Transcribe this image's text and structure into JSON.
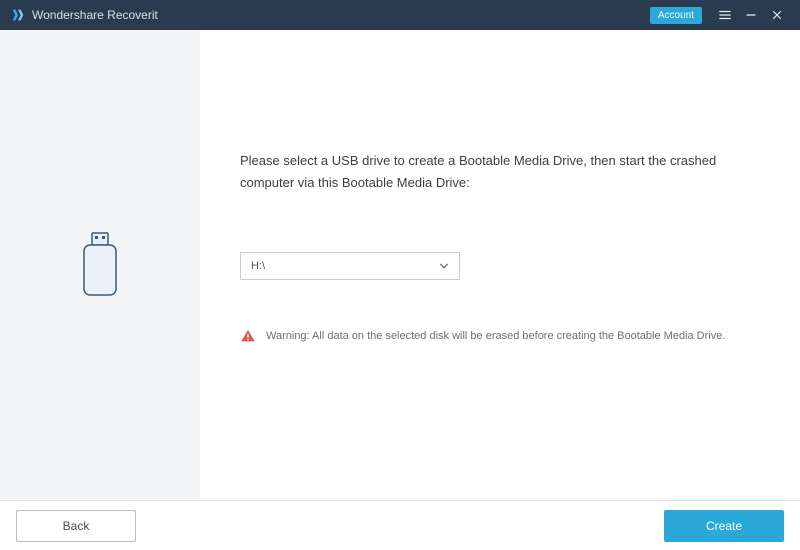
{
  "titlebar": {
    "app_name": "Wondershare Recoverit",
    "account_label": "Account"
  },
  "main": {
    "instruction": "Please select a USB drive to create a Bootable Media Drive, then start the crashed computer via this Bootable Media Drive:",
    "selected_drive": "H:\\",
    "warning": "Warning: All data on the selected disk will be erased before creating the Bootable Media Drive."
  },
  "footer": {
    "back_label": "Back",
    "create_label": "Create"
  },
  "colors": {
    "accent": "#2aa8d8",
    "titlebar_bg": "#2a3a4f",
    "warning_icon": "#d9534f"
  }
}
